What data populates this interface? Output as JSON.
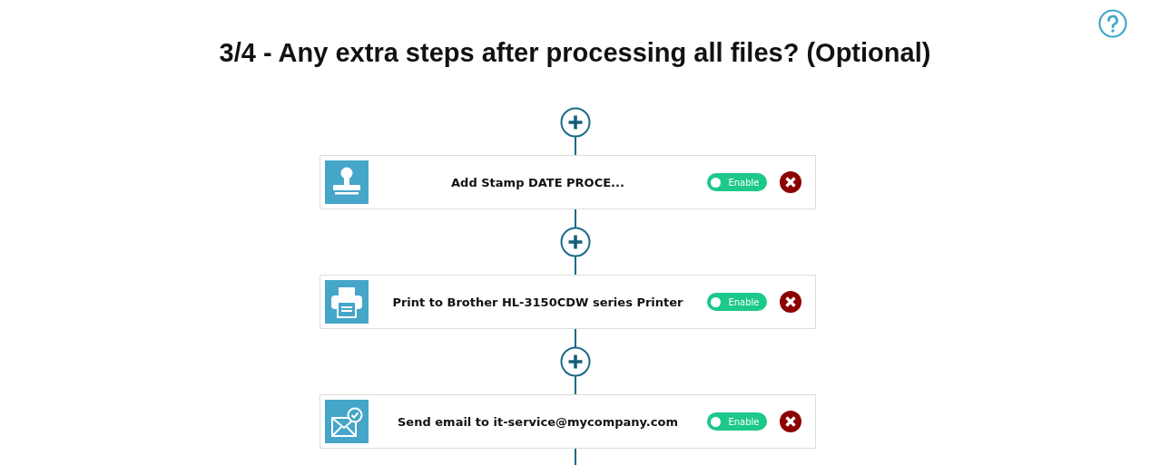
{
  "title": "3/4 - Any extra steps after processing all files? (Optional)",
  "steps": [
    {
      "kind": "stamp",
      "label": "Add Stamp DATE PROCE...",
      "enabled": true,
      "toggle_label": "Enable"
    },
    {
      "kind": "printer",
      "label": "Print to Brother HL-3150CDW series Printer",
      "enabled": true,
      "toggle_label": "Enable"
    },
    {
      "kind": "email",
      "label": "Send email to it-service@mycompany.com",
      "enabled": true,
      "toggle_label": "Enable"
    }
  ]
}
